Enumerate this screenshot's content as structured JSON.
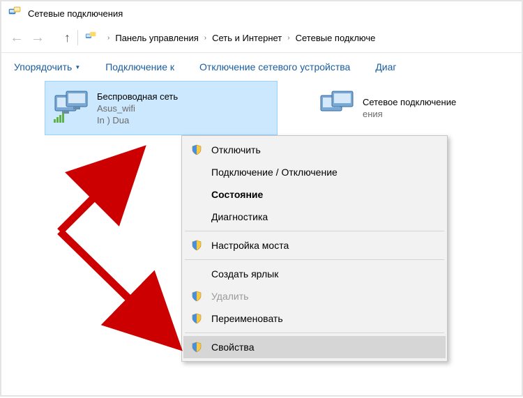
{
  "window": {
    "title": "Сетевые подключения"
  },
  "breadcrumbs": {
    "b1": "Панель управления",
    "b2": "Сеть и Интернет",
    "b3": "Сетевые подключе"
  },
  "toolbar": {
    "organize": "Упорядочить",
    "connect": "Подключение к",
    "disable": "Отключение сетевого устройства",
    "diag": "Диаг"
  },
  "connections": {
    "wifi": {
      "name": "Беспроводная сеть",
      "ssid": "Asus_wifi",
      "adapter": "In          ) Dua"
    },
    "eth": {
      "name": "Сетевое подключение",
      "status": "ения"
    }
  },
  "menu": {
    "disconnect": "Отключить",
    "connect_disconnect": "Подключение / Отключение",
    "status": "Состояние",
    "diagnose": "Диагностика",
    "bridge": "Настройка моста",
    "shortcut": "Создать ярлык",
    "delete": "Удалить",
    "rename": "Переименовать",
    "properties": "Свойства"
  }
}
